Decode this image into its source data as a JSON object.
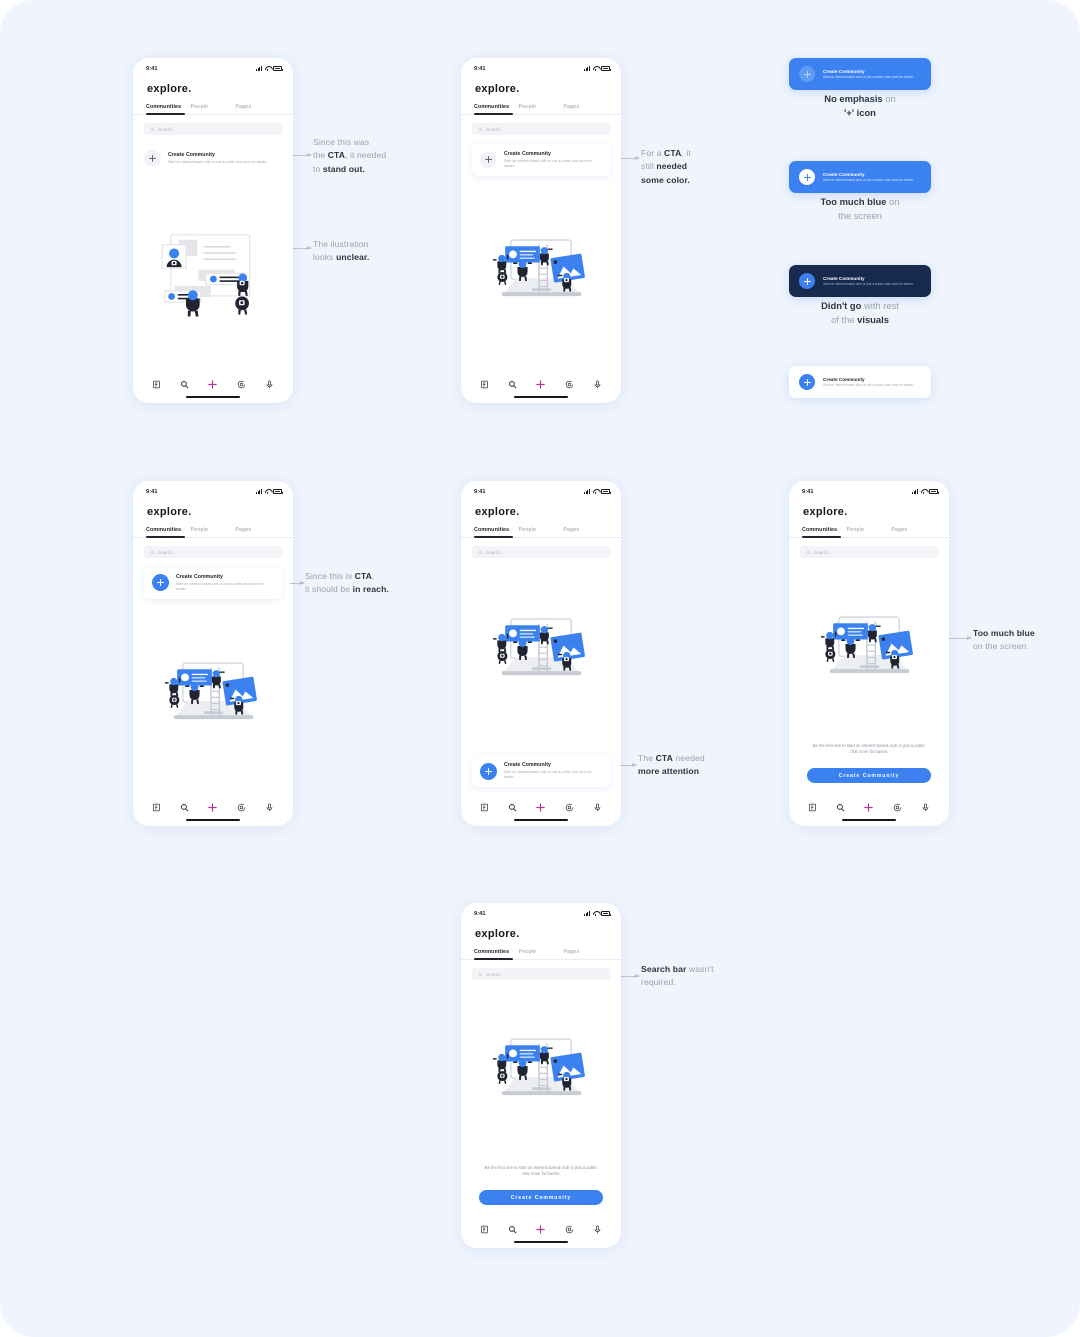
{
  "page": {
    "background": "#eff4fd"
  },
  "colors": {
    "blue": "#3b82f0",
    "light_blue": "#5c9bf5",
    "navy": "#17294d",
    "accent_plus": "#b5379a",
    "text_dark": "#2d3542",
    "text_muted": "#9aa3b2"
  },
  "phone_common": {
    "status_time": "9:41",
    "brand": "explore.",
    "tabs": [
      "Communities",
      "People",
      "Pages"
    ],
    "active_tab": "Communities",
    "search_placeholder": "Search",
    "cta_title": "Create Community",
    "cta_subtitle": "Start an interest based club or just a public chat room for banter.",
    "empty_text": "Be the first one to start an interest based club or just a public chat room for banter.",
    "big_button_label": "Create Community",
    "nav_items": [
      "feed-icon",
      "search-icon",
      "plus-icon",
      "chat-icon",
      "mic-icon"
    ]
  },
  "screens": [
    {
      "id": "screen-1",
      "has_search": true,
      "cta_style": "plain-grey",
      "illustration": "unclear",
      "cta_position": "top"
    },
    {
      "id": "screen-2",
      "has_search": true,
      "cta_style": "card-grey",
      "illustration": "clear",
      "cta_position": "top"
    },
    {
      "id": "screen-3",
      "has_search": true,
      "cta_style": "card-blue",
      "illustration": "clear",
      "cta_position": "top"
    },
    {
      "id": "screen-4",
      "has_search": true,
      "cta_style": "card-blue",
      "illustration": "clear",
      "cta_position": "bottom"
    },
    {
      "id": "screen-5",
      "has_search": true,
      "cta_style": "button",
      "illustration": "clear",
      "cta_position": "bottom"
    },
    {
      "id": "screen-6",
      "has_search": true,
      "cta_style": "button",
      "illustration": "clear",
      "cta_position": "bottom"
    }
  ],
  "annotations": [
    {
      "id": "anno-cta-standout",
      "lines": [
        [
          [
            "Since this was",
            false
          ]
        ],
        [
          [
            "the ",
            false
          ],
          [
            "CTA",
            true
          ],
          [
            ", it needed",
            false
          ]
        ],
        [
          [
            "to ",
            false
          ],
          [
            "stand out.",
            true
          ]
        ]
      ]
    },
    {
      "id": "anno-illustration-unclear",
      "lines": [
        [
          [
            "The ilustration",
            false
          ]
        ],
        [
          [
            "looks ",
            false
          ],
          [
            "unclear.",
            true
          ]
        ]
      ]
    },
    {
      "id": "anno-needed-color",
      "lines": [
        [
          [
            "For a ",
            false
          ],
          [
            "CTA",
            true
          ],
          [
            ", it",
            false
          ]
        ],
        [
          [
            "still ",
            false
          ],
          [
            "needed",
            true
          ]
        ],
        [
          [
            "some color.",
            true
          ]
        ]
      ]
    },
    {
      "id": "anno-in-reach",
      "lines": [
        [
          [
            "Since this is ",
            false
          ],
          [
            "CTA",
            true
          ],
          [
            ",",
            false
          ]
        ],
        [
          [
            "it should be ",
            false
          ],
          [
            "in reach.",
            true
          ]
        ]
      ]
    },
    {
      "id": "anno-more-attention",
      "lines": [
        [
          [
            "The ",
            false
          ],
          [
            "CTA",
            true
          ],
          [
            " needed",
            false
          ]
        ],
        [
          [
            "more attention",
            true
          ]
        ]
      ]
    },
    {
      "id": "anno-too-much-blue",
      "lines": [
        [
          [
            "Too much blue",
            true
          ]
        ],
        [
          [
            "on the screen.",
            false
          ]
        ]
      ]
    },
    {
      "id": "anno-search-not-required",
      "lines": [
        [
          [
            "Search bar",
            true
          ],
          [
            " wasn't",
            false
          ]
        ],
        [
          [
            "required.",
            false
          ]
        ]
      ]
    }
  ],
  "variants": [
    {
      "id": "variant-1",
      "bg": "#3b82f0",
      "circle_bg": "#5f9bf4",
      "plus_color": "#bcd6fb",
      "title_color": "#ffffff",
      "sub_color": "#cfe0fb",
      "title": "Create Community",
      "subtitle": "Start an interest based club or just a public chat room for banter.",
      "caption": [
        [
          [
            "No emphasis",
            true
          ],
          [
            " on",
            false
          ]
        ],
        [
          [
            "'+' icon",
            true
          ]
        ]
      ]
    },
    {
      "id": "variant-2",
      "bg": "#3b82f0",
      "circle_bg": "#ffffff",
      "plus_color": "#3b82f0",
      "title_color": "#ffffff",
      "sub_color": "#cfe0fb",
      "title": "Create Community",
      "subtitle": "Start an interest based club or just a public chat room for banter.",
      "caption": [
        [
          [
            "Too much blue",
            true
          ],
          [
            " on",
            false
          ]
        ],
        [
          [
            "the screen",
            false
          ]
        ]
      ]
    },
    {
      "id": "variant-3",
      "bg": "#17294d",
      "circle_bg": "#3b82f0",
      "plus_color": "#ffffff",
      "title_color": "#ffffff",
      "sub_color": "#9fb2d2",
      "title": "Create Community",
      "subtitle": "Start an interest based club or just a public chat room for banter.",
      "caption": [
        [
          [
            "Didn't go",
            true
          ],
          [
            " with rest",
            false
          ]
        ],
        [
          [
            "of the ",
            false
          ],
          [
            "visuals",
            true
          ]
        ]
      ]
    },
    {
      "id": "variant-4",
      "bg": "#ffffff",
      "circle_bg": "#3b82f0",
      "plus_color": "#ffffff",
      "title_color": "#20242c",
      "sub_color": "#a6acb7",
      "title": "Create Community",
      "subtitle": "Start an interest based club or just a public chat room for banter.",
      "caption": []
    }
  ]
}
